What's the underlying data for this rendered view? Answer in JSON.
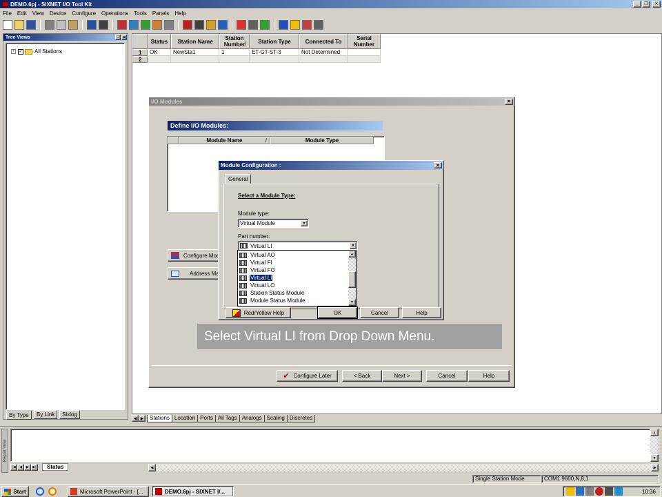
{
  "app": {
    "title": "DEMO.6pj - SIXNET I/O Tool Kit",
    "menu": [
      "File",
      "Edit",
      "View",
      "Device",
      "Configure",
      "Operations",
      "Tools",
      "Panels",
      "Help"
    ]
  },
  "tree": {
    "title": "Tree Views",
    "root_label": "All Stations",
    "tabs": [
      "By Type",
      "By Link",
      "Sixlog"
    ]
  },
  "grid": {
    "columns": [
      "Status",
      "Station Name",
      "Station Number",
      "Station Type",
      "Connected To",
      "Serial Number"
    ],
    "rows": [
      {
        "num": "1",
        "status": "OK",
        "name": "NewSta1",
        "number": "1",
        "type": "ET-GT-ST-3",
        "connected": "Not Determined",
        "serial": ""
      },
      {
        "num": "2",
        "status": "",
        "name": "",
        "number": "",
        "type": "",
        "connected": "",
        "serial": ""
      }
    ],
    "sheet_tabs": [
      "Stations",
      "Location",
      "Ports",
      "All Tags",
      "Analogs",
      "Scaling",
      "Discretes"
    ]
  },
  "io_dialog": {
    "title": "I/O Modules",
    "heading": "Define I/O Modules:",
    "columns": [
      "Module Name",
      "Module Type"
    ],
    "side_buttons": [
      "Configure Mod",
      "Address Ma"
    ],
    "bottom_buttons": [
      "Configure Later",
      "< Back",
      "Next >",
      "Cancel",
      "Help"
    ]
  },
  "mod_dialog": {
    "title": "Module Configuration :",
    "tab": "General",
    "section": "Select a Module Type:",
    "type_label": "Module type:",
    "type_value": "Virtual Module",
    "part_label": "Part number:",
    "part_value": "Virtual LI",
    "options": [
      "Virtual AO",
      "Virtual FI",
      "Virtual FO",
      "Virtual LI",
      "Virtual LO",
      "Station Status Module",
      "Module Status Module"
    ],
    "selected_option": "Virtual LI",
    "buttons": {
      "help": "Red/Yellow Help",
      "ok": "OK",
      "cancel": "Cancel",
      "helpbtn": "Help"
    }
  },
  "caption": "Select Virtual LI from Drop Down Menu.",
  "report": {
    "side_label": "Report View",
    "tab": "Status"
  },
  "status_bar": {
    "mode": "Single Station Mode",
    "port": "COM1 9600,N,8,1"
  },
  "taskbar": {
    "start": "Start",
    "tasks": [
      "Microsoft PowerPoint - [...",
      "DEMO.6pj - SIXNET I/..."
    ],
    "clock": "10:36"
  },
  "colors": {
    "title_active": "#0a246a",
    "title_gradient_end": "#a6caf0",
    "selection": "#0a246a",
    "face": "#d4d0c8",
    "caption_bg": "#a0a0a0"
  }
}
